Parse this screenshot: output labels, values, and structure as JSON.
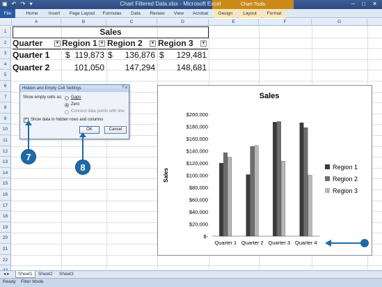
{
  "window": {
    "title": "Chart Filtered Data.xlsx - Microsoft Excel",
    "context_tab_group": "Chart Tools",
    "qat_icons": [
      "save-icon",
      "undo-icon",
      "redo-icon"
    ],
    "window_buttons": [
      "-",
      "□",
      "x"
    ]
  },
  "ribbon": {
    "tabs": [
      "File",
      "Home",
      "Insert",
      "Page Layout",
      "Formulas",
      "Data",
      "Review",
      "View",
      "Acrobat",
      "Design",
      "Layout",
      "Format"
    ]
  },
  "grid": {
    "columns": [
      "A",
      "B",
      "C",
      "D",
      "E",
      "F",
      "G"
    ],
    "rows": [
      "1",
      "2",
      "3",
      "4",
      "5",
      "6",
      "7",
      "8",
      "9",
      "10",
      "11",
      "12",
      "13",
      "14",
      "15",
      "16",
      "17",
      "18",
      "19",
      "20",
      "21",
      "22",
      "23"
    ]
  },
  "table": {
    "title": "Sales",
    "headers": [
      "Quarter",
      "Region 1",
      "Region 2",
      "Region 3"
    ],
    "rows": [
      {
        "quarter": "Quarter 1",
        "r1_sym": "$",
        "r1": "119,873",
        "r2_sym": "$",
        "r2": "136,876",
        "r3_sym": "$",
        "r3": "129,481"
      },
      {
        "quarter": "Quarter 2",
        "r1_sym": "",
        "r1": "101,050",
        "r2_sym": "",
        "r2": "147,294",
        "r3_sym": "",
        "r3": "148,681"
      }
    ]
  },
  "dialog": {
    "title": "Hidden and Empty Cell Settings",
    "show_empty_label": "Show empty cells as:",
    "options": [
      "Gaps",
      "Zero",
      "Connect data points with line"
    ],
    "selected_option": "Zero",
    "checkbox_label": "Show data in hidden rows and columns",
    "checkbox_checked": true,
    "ok_label": "OK",
    "cancel_label": "Cancel",
    "title_buttons": "? x"
  },
  "callouts": {
    "step7": "7",
    "step8": "8"
  },
  "chart_data": {
    "type": "bar",
    "title": "Sales",
    "xlabel": "",
    "ylabel": "Sales",
    "categories": [
      "Quarter 1",
      "Quarter 2",
      "Quarter 3",
      "Quarter 4"
    ],
    "series": [
      {
        "name": "Region 1",
        "values": [
          119873,
          101050,
          187000,
          186000
        ]
      },
      {
        "name": "Region 2",
        "values": [
          136876,
          147294,
          188000,
          178000
        ]
      },
      {
        "name": "Region 3",
        "values": [
          129481,
          148681,
          123000,
          100000
        ]
      }
    ],
    "ylim": [
      0,
      200000
    ],
    "yticks": [
      "$-",
      "$20,000",
      "$40,000",
      "$60,000",
      "$80,000",
      "$100,000",
      "$120,000",
      "$140,000",
      "$160,000",
      "$180,000",
      "$200,000"
    ],
    "legend_position": "right",
    "colors": [
      "#3a3a3a",
      "#6e6e6e",
      "#b8b8b8"
    ]
  },
  "sheets": {
    "tabs": [
      "Sheet1",
      "Sheet2",
      "Sheet3"
    ],
    "active": "Sheet1"
  },
  "status": {
    "ready": "Ready",
    "mode": "Filter Mode"
  }
}
